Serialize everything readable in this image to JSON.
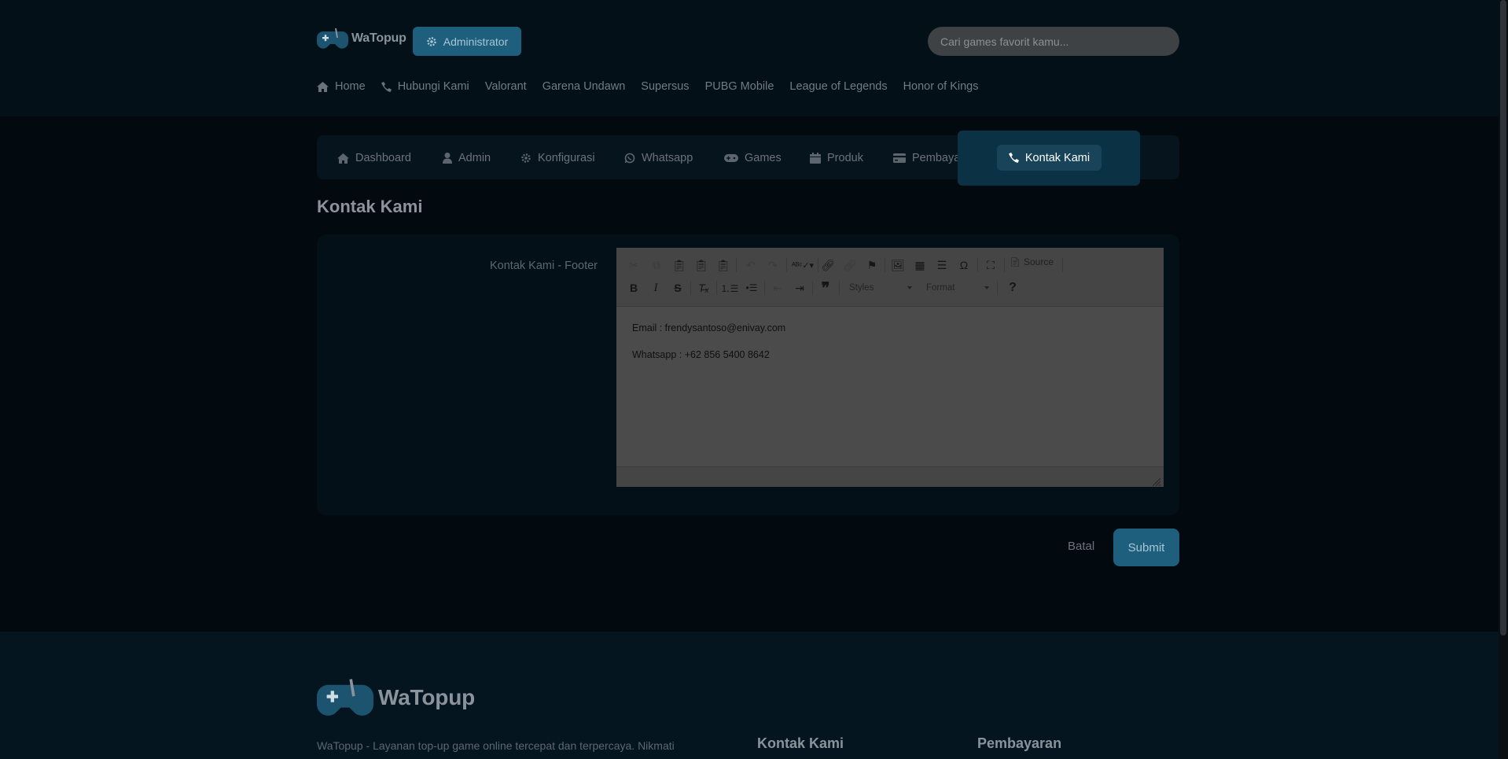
{
  "header": {
    "logo_text": "WaTopup",
    "admin_button": "Administrator",
    "search_placeholder": "Cari games favorit kamu..."
  },
  "topnav": {
    "items": [
      "Home",
      "Hubungi Kami",
      "Valorant",
      "Garena Undawn",
      "Supersus",
      "PUBG Mobile",
      "League of Legends",
      "Honor of Kings"
    ]
  },
  "tabs": {
    "items": [
      "Dashboard",
      "Admin",
      "Konfigurasi",
      "Whatsapp",
      "Games",
      "Produk",
      "Pembayaran",
      "Kontak Kami"
    ],
    "active": "Kontak Kami"
  },
  "page": {
    "title": "Kontak Kami",
    "field_label": "Kontak Kami - Footer"
  },
  "editor": {
    "source_label": "Source",
    "styles_label": "Styles",
    "format_label": "Format",
    "content_lines": [
      "Email : frendysantoso@enivay.com",
      "Whatsapp : +62 856 5400 8642"
    ]
  },
  "actions": {
    "cancel": "Batal",
    "submit": "Submit"
  },
  "footer": {
    "logo_text": "WaTopup",
    "description": "WaTopup - Layanan top-up game online tercepat dan terpercaya. Nikmati",
    "heading_contact": "Kontak Kami",
    "heading_payment": "Pembayaran"
  },
  "colors": {
    "accent": "#1e5f7e",
    "background": "#040d14",
    "active_tab": "#184359"
  }
}
